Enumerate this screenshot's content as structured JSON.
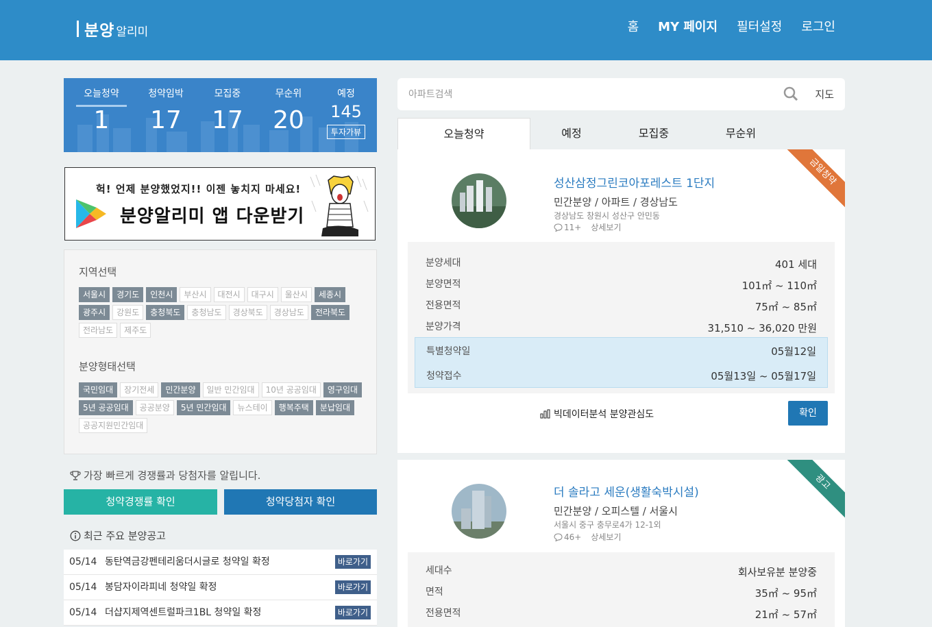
{
  "header": {
    "logo_main": "분양",
    "logo_sub": "알리미",
    "nav": [
      "홈",
      "MY 페이지",
      "필터설정",
      "로그인"
    ]
  },
  "stats": {
    "items": [
      {
        "label": "오늘청약",
        "value": "1"
      },
      {
        "label": "청약임박",
        "value": "17"
      },
      {
        "label": "모집중",
        "value": "17"
      },
      {
        "label": "무순위",
        "value": "20"
      }
    ],
    "last": {
      "label": "예정",
      "value": "145",
      "tag": "투자가뷰"
    }
  },
  "banner": {
    "line1": "헉! 언제 분양했었지!! 이젠 놓치지 마세요!",
    "line2": "분양알리미 앱 다운받기"
  },
  "region": {
    "title": "지역선택",
    "chips": [
      {
        "label": "서울시",
        "on": true
      },
      {
        "label": "경기도",
        "on": true
      },
      {
        "label": "인천시",
        "on": true
      },
      {
        "label": "부산시",
        "on": false
      },
      {
        "label": "대전시",
        "on": false
      },
      {
        "label": "대구시",
        "on": false
      },
      {
        "label": "울산시",
        "on": false
      },
      {
        "label": "세종시",
        "on": true
      },
      {
        "label": "광주시",
        "on": true
      },
      {
        "label": "강원도",
        "on": false
      },
      {
        "label": "충청북도",
        "on": true
      },
      {
        "label": "충청남도",
        "on": false
      },
      {
        "label": "경상북도",
        "on": false
      },
      {
        "label": "경상남도",
        "on": false
      },
      {
        "label": "전라북도",
        "on": true
      },
      {
        "label": "전라남도",
        "on": false
      },
      {
        "label": "제주도",
        "on": false
      }
    ]
  },
  "saletype": {
    "title": "분양형태선택",
    "chips": [
      {
        "label": "국민임대",
        "on": true
      },
      {
        "label": "장기전세",
        "on": false
      },
      {
        "label": "민간분양",
        "on": true
      },
      {
        "label": "일반 민간임대",
        "on": false
      },
      {
        "label": "10년 공공임대",
        "on": false
      },
      {
        "label": "영구임대",
        "on": true
      },
      {
        "label": "5년 공공임대",
        "on": true
      },
      {
        "label": "공공분양",
        "on": false
      },
      {
        "label": "5년 민간임대",
        "on": true
      },
      {
        "label": "뉴스테이",
        "on": false
      },
      {
        "label": "행복주택",
        "on": true
      },
      {
        "label": "분납임대",
        "on": true
      },
      {
        "label": "공공지원민간임대",
        "on": false
      }
    ]
  },
  "notice": "가장 빠르게 경쟁률과 당첨자를 알립니다.",
  "buttons": {
    "competition": "청약경쟁률 확인",
    "winners": "청약당첨자 확인"
  },
  "recent": {
    "title": "최근 주요 분양공고",
    "go_label": "바로가기",
    "rows": [
      {
        "date": "05/14",
        "text": "동탄역금강펜테리움더시글로 청약일 확정"
      },
      {
        "date": "05/14",
        "text": "봉담자이라피네 청약일 확정"
      },
      {
        "date": "05/14",
        "text": "더샵지제역센트럴파크1BL 청약일 확정"
      }
    ]
  },
  "search": {
    "placeholder": "아파트검색",
    "map_label": "지도"
  },
  "tabs": [
    "오늘청약",
    "예정",
    "모집중",
    "무순위"
  ],
  "cards": [
    {
      "ribbon": "금일청약",
      "ribbon_color": "#e0763a",
      "title": "성산삼정그린코아포레스트 1단지",
      "type": "민간분양 / 아파트 / 경상남도",
      "addr": "경상남도 창원시 성산구 안민동",
      "comments": "11+",
      "detail": "상세보기",
      "rows": [
        {
          "k": "분양세대",
          "v": "401 세대"
        },
        {
          "k": "분양면적",
          "v": "101㎡ ~ 110㎡"
        },
        {
          "k": "전용면적",
          "v": "75㎡ ~ 85㎡"
        },
        {
          "k": "분양가격",
          "v": "31,510 ~ 36,020 만원"
        }
      ],
      "schedule": [
        {
          "k": "특별청약일",
          "v": "05월12일"
        },
        {
          "k": "청약접수",
          "v": "05월13일 ~ 05월17일"
        }
      ],
      "bigdata": "빅데이터분석 분양관심도",
      "confirm": "확인"
    },
    {
      "ribbon": "광고",
      "ribbon_color": "#2f8f80",
      "title": "더 솔라고 세운(생활숙박시설)",
      "type": "민간분양 / 오피스텔 / 서울시",
      "addr": "서울시 중구 충무로4가 12-1외",
      "comments": "46+",
      "detail": "상세보기",
      "rows": [
        {
          "k": "세대수",
          "v": "회사보유분 분양중"
        },
        {
          "k": "면적",
          "v": "35㎡ ~ 95㎡"
        },
        {
          "k": "전용면적",
          "v": "21㎡ ~ 57㎡"
        }
      ]
    }
  ]
}
